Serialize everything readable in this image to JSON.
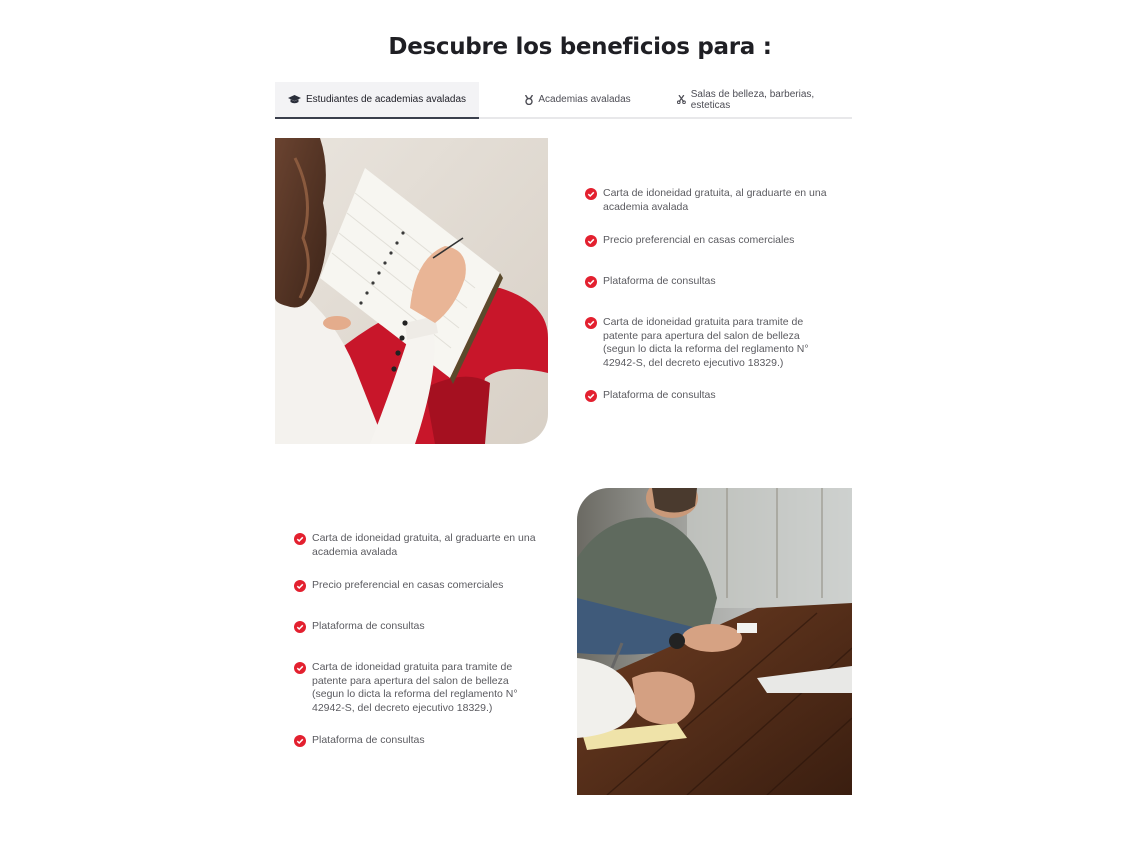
{
  "heading": "Descubre los beneficios para :",
  "tabs": [
    {
      "label": "Estudiantes de academias avaladas",
      "icon": "graduation-cap-icon",
      "active": true
    },
    {
      "label": "Academias avaladas",
      "icon": "medal-icon",
      "active": false
    },
    {
      "label": "Salas de belleza, barberias, esteticas",
      "icon": "scissors-icon",
      "active": false
    }
  ],
  "section1": {
    "image": "woman-writing-notebook-photo",
    "benefits": [
      "Carta de idoneidad gratuita, al graduarte en una academia avalada",
      "Precio preferencial en casas comerciales",
      "Plataforma de consultas",
      "Carta de idoneidad gratuita para tramite de patente para apertura del salon de belleza (segun lo dicta la reforma del reglamento N° 42942-S, del decreto ejecutivo 18329.)",
      "Plataforma de consultas"
    ]
  },
  "section2": {
    "image": "people-meeting-table-photo",
    "benefits": [
      "Carta de idoneidad gratuita, al graduarte en una academia avalada",
      "Precio preferencial en casas comerciales",
      "Plataforma de consultas",
      "Carta de idoneidad gratuita para tramite de patente para apertura del salon de belleza (segun lo dicta la reforma del reglamento N° 42942-S, del decreto ejecutivo 18329.)",
      "Plataforma de consultas"
    ]
  },
  "colors": {
    "accent": "#e3202f",
    "heading": "#1f1f24",
    "tab_underline": "#3a3f4c"
  }
}
